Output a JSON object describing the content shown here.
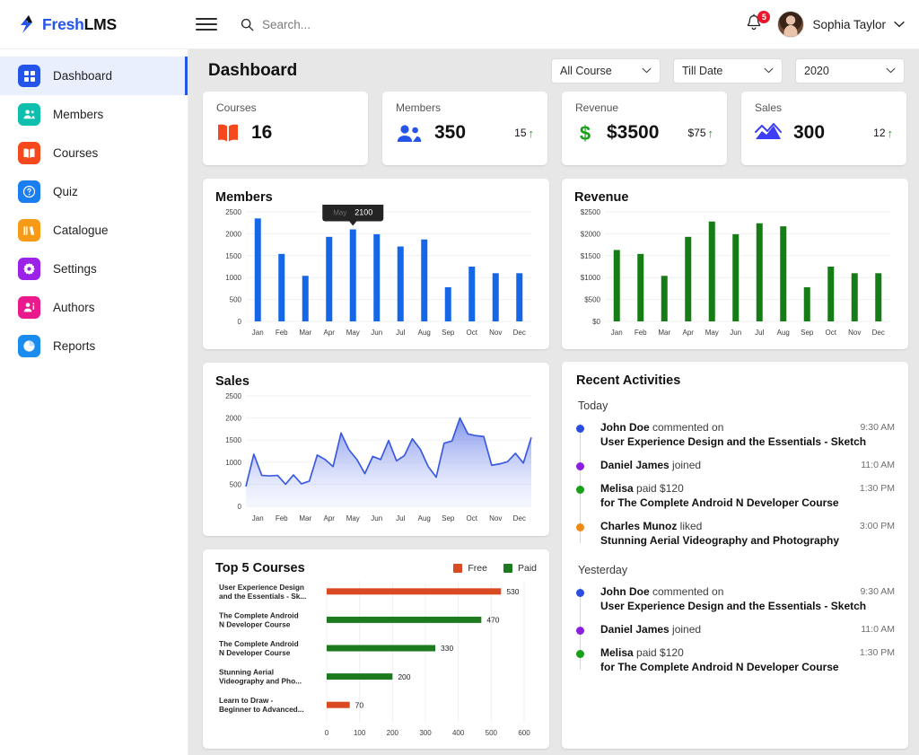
{
  "brand": {
    "part1": "Fresh",
    "part2": "LMS",
    "logo_icon": "lightning-bolt-icon"
  },
  "topbar": {
    "menu_icon": "hamburger-menu-icon",
    "search_icon": "search-icon",
    "search_placeholder": "Search...",
    "bell_icon": "notification-bell-icon",
    "notification_count": "5",
    "user_name": "Sophia Taylor",
    "user_chevron_icon": "chevron-down-icon"
  },
  "sidebar": {
    "items": [
      {
        "label": "Dashboard",
        "icon": "dashboard-grid-icon",
        "color": "#2454e8",
        "active": true
      },
      {
        "label": "Members",
        "icon": "members-people-icon",
        "color": "#0fbfae",
        "active": false
      },
      {
        "label": "Courses",
        "icon": "book-icon",
        "color": "#f5481c",
        "active": false
      },
      {
        "label": "Quiz",
        "icon": "question-mark-icon",
        "color": "#1a7ef0",
        "active": false
      },
      {
        "label": "Catalogue",
        "icon": "catalogue-icon",
        "color": "#f79b16",
        "active": false
      },
      {
        "label": "Settings",
        "icon": "gear-icon",
        "color": "#9b22e6",
        "active": false
      },
      {
        "label": "Authors",
        "icon": "author-person-icon",
        "color": "#ea1a8c",
        "active": false
      },
      {
        "label": "Reports",
        "icon": "pie-chart-icon",
        "color": "#1a8cf0",
        "active": false
      }
    ]
  },
  "header": {
    "title": "Dashboard",
    "filters": [
      {
        "name": "course-filter",
        "value": "All Course"
      },
      {
        "name": "date-filter",
        "value": "Till Date"
      },
      {
        "name": "year-filter",
        "value": "2020"
      }
    ]
  },
  "stats": [
    {
      "label": "Courses",
      "value": "16",
      "delta": "",
      "icon": "book-icon",
      "color": "#f5481c"
    },
    {
      "label": "Members",
      "value": "350",
      "delta": "15",
      "icon": "people-icon",
      "color": "#2454e8"
    },
    {
      "label": "Revenue",
      "value": "$3500",
      "delta": "$75",
      "icon": "dollar-icon",
      "color": "#18a018"
    },
    {
      "label": "Sales",
      "value": "300",
      "delta": "12",
      "icon": "area-chart-icon",
      "color": "#3d3df5"
    }
  ],
  "chart_data": [
    {
      "type": "bar",
      "title": "Members",
      "categories": [
        "Jan",
        "Feb",
        "Mar",
        "Apr",
        "May",
        "Jun",
        "Jul",
        "Aug",
        "Sep",
        "Oct",
        "Nov",
        "Dec"
      ],
      "values": [
        2350,
        1540,
        1040,
        1930,
        2100,
        1990,
        1710,
        1870,
        780,
        1250,
        1100,
        1100
      ],
      "yticks": [
        0,
        500,
        1000,
        1500,
        2000,
        2500
      ],
      "ytick_labels": [
        "0",
        "500",
        "1000",
        "1500",
        "2000",
        "2500"
      ],
      "ylim": [
        0,
        2500
      ],
      "xlabel": "",
      "ylabel": "",
      "series_color": "#1567e8",
      "grid": true,
      "legend": "none",
      "tooltip": {
        "category": "May",
        "value": "2100",
        "visible": true
      }
    },
    {
      "type": "bar",
      "title": "Revenue",
      "categories": [
        "Jan",
        "Feb",
        "Mar",
        "Apr",
        "May",
        "Jun",
        "Jul",
        "Aug",
        "Sep",
        "Oct",
        "Nov",
        "Dec"
      ],
      "values": [
        1630,
        1540,
        1040,
        1930,
        2280,
        1990,
        2240,
        2170,
        780,
        1250,
        1100,
        1100
      ],
      "yticks": [
        0,
        500,
        1000,
        1500,
        2000,
        2500
      ],
      "ytick_labels": [
        "$0",
        "$500",
        "$1000",
        "$1500",
        "$2000",
        "$2500"
      ],
      "ylim": [
        0,
        2500
      ],
      "xlabel": "",
      "ylabel": "",
      "series_color": "#167d16",
      "grid": true,
      "legend": "none"
    },
    {
      "type": "area",
      "title": "Sales",
      "categories": [
        "Jan",
        "Feb",
        "Mar",
        "Apr",
        "May",
        "Jun",
        "Jul",
        "Aug",
        "Sep",
        "Oct",
        "Nov",
        "Dec"
      ],
      "yticks": [
        0,
        500,
        1000,
        1500,
        2000,
        2500
      ],
      "ytick_labels": [
        "0",
        "500",
        "1000",
        "1500",
        "2000",
        "2500"
      ],
      "ylim": [
        0,
        2500
      ],
      "xlabel": "",
      "ylabel": "",
      "series_color": "#3a5be0",
      "grid": true,
      "legend": "none",
      "values": [
        450,
        1180,
        700,
        690,
        700,
        500,
        710,
        510,
        570,
        1160,
        1060,
        900,
        1660,
        1280,
        1060,
        740,
        1130,
        1060,
        1490,
        1030,
        1150,
        1530,
        1290,
        900,
        660,
        1430,
        1480,
        2000,
        1640,
        1600,
        1580,
        930,
        960,
        1010,
        1200,
        980,
        1560
      ]
    },
    {
      "type": "bar",
      "orientation": "horizontal",
      "title": "Top 5 Courses",
      "categories": [
        "User Experience Design and the Essentials - Sk...",
        "The Complete Android N Developer Course",
        "The Complete Android N Developer Course",
        "Stunning Aerial Videography and Pho...",
        "Learn to Draw - Beginner to Advanced..."
      ],
      "category_lines": [
        [
          "User Experience Design",
          "and the Essentials - Sk..."
        ],
        [
          "The Complete Android",
          "N Developer Course"
        ],
        [
          "The Complete Android",
          "N Developer Course"
        ],
        [
          "Stunning Aerial",
          "Videography and Pho..."
        ],
        [
          "Learn to Draw -",
          "Beginner to Advanced..."
        ]
      ],
      "values": [
        530,
        470,
        330,
        200,
        70
      ],
      "types": [
        "Free",
        "Paid",
        "Paid",
        "Paid",
        "Free"
      ],
      "xticks": [
        0,
        100,
        200,
        300,
        400,
        500,
        600
      ],
      "xtick_labels": [
        "0",
        "100",
        "200",
        "300",
        "400",
        "500",
        "600"
      ],
      "xlim": [
        0,
        600
      ],
      "xlabel": "",
      "ylabel": "",
      "grid": true,
      "legend": "top-right",
      "legend_entries": [
        {
          "label": "Free",
          "color": "#d94a21"
        },
        {
          "label": "Paid",
          "color": "#1e7a1e"
        }
      ]
    }
  ],
  "activities": {
    "title": "Recent Activities",
    "groups": [
      {
        "label": "Today",
        "items": [
          {
            "actor": "John Doe",
            "action": " commented on",
            "detail": "User Experience Design and the Essentials - Sketch",
            "time": "9:30 AM",
            "dot": "#2b4ce0"
          },
          {
            "actor": "Daniel James",
            "action": " joined",
            "detail": "",
            "time": "11:0 AM",
            "dot": "#8a1fe0"
          },
          {
            "actor": "Melisa",
            "action": " paid $120",
            "detail": "for The Complete Android N Developer Course",
            "time": "1:30 PM",
            "dot": "#19a019"
          },
          {
            "actor": "Charles Munoz",
            "action": " liked",
            "detail": "Stunning Aerial Videography and Photography",
            "time": "3:00 PM",
            "dot": "#f08a16"
          }
        ]
      },
      {
        "label": "Yesterday",
        "items": [
          {
            "actor": "John Doe",
            "action": " commented on",
            "detail": "User Experience Design and the Essentials - Sketch",
            "time": "9:30 AM",
            "dot": "#2b4ce0"
          },
          {
            "actor": "Daniel James",
            "action": " joined",
            "detail": "",
            "time": "11:0 AM",
            "dot": "#8a1fe0"
          },
          {
            "actor": "Melisa",
            "action": " paid $120",
            "detail": "for The Complete Android N Developer Course",
            "time": "1:30 PM",
            "dot": "#19a019"
          }
        ]
      }
    ]
  }
}
